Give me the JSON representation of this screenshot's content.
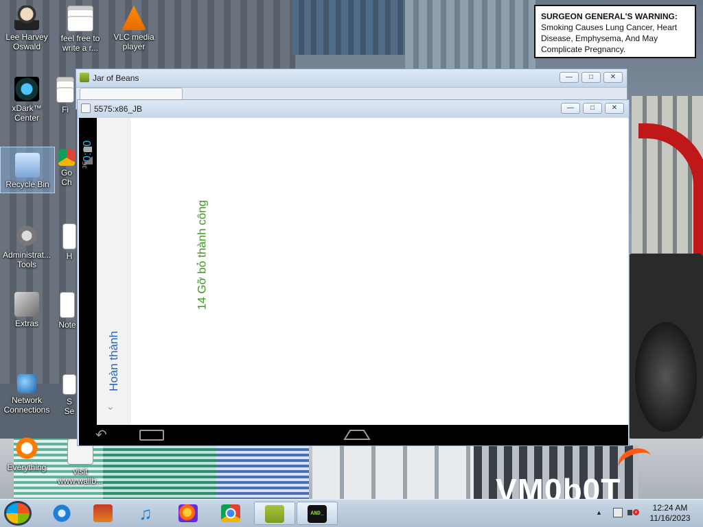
{
  "warning": {
    "head": "SURGEON GENERAL'S WARNING:",
    "body": "Smoking Causes Lung Cancer, Heart Disease, Emphysema, And May Complicate Pregnancy."
  },
  "wallpaper_brand": "VM0b0T",
  "desktop_icons": [
    {
      "label": "Lee Harvey Oswald",
      "icon": "person-icon"
    },
    {
      "label": "feel free to write a r...",
      "icon": "document-icon"
    },
    {
      "label": "VLC media player",
      "icon": "vlc-icon"
    },
    {
      "label": "xDark™ Center",
      "icon": "xdark-icon"
    },
    {
      "label": "Fi",
      "icon": "document-icon"
    },
    {
      "label": "Recycle Bin",
      "icon": "recycle-bin-icon"
    },
    {
      "label": "Go Ch",
      "icon": "chrome-icon"
    },
    {
      "label": "Administrat... Tools",
      "icon": "gear-icon"
    },
    {
      "label": "H",
      "icon": "document-icon"
    },
    {
      "label": "Extras",
      "icon": "folder-icon"
    },
    {
      "label": "Note",
      "icon": "document-icon"
    },
    {
      "label": "Network Connections",
      "icon": "network-icon"
    },
    {
      "label": "S Se",
      "icon": "document-icon"
    },
    {
      "label": "Everything",
      "icon": "everything-icon"
    },
    {
      "label": "visit www.wallb...",
      "icon": "web-shortcut-icon"
    }
  ],
  "windows": {
    "outer": {
      "title": "Jar of Beans"
    },
    "emulator": {
      "title": "5575:x86_JB"
    }
  },
  "android": {
    "clock": "0:20",
    "network": "3G",
    "done_button": "Hoàn thành",
    "message": "14 Gỡ bỏ thành công"
  },
  "taskbar": {
    "time": "12:24 AM",
    "date": "11/16/2023",
    "apps": [
      "internet-explorer-icon",
      "store-icon",
      "music-icon",
      "firefox-icon",
      "chrome-icon",
      "android-icon",
      "and-terminal-icon"
    ],
    "and_label": "AND_"
  },
  "colors": {
    "message_green": "#3c9a1e",
    "done_blue": "#2a66b5",
    "clock_blue": "#33b5e5"
  }
}
